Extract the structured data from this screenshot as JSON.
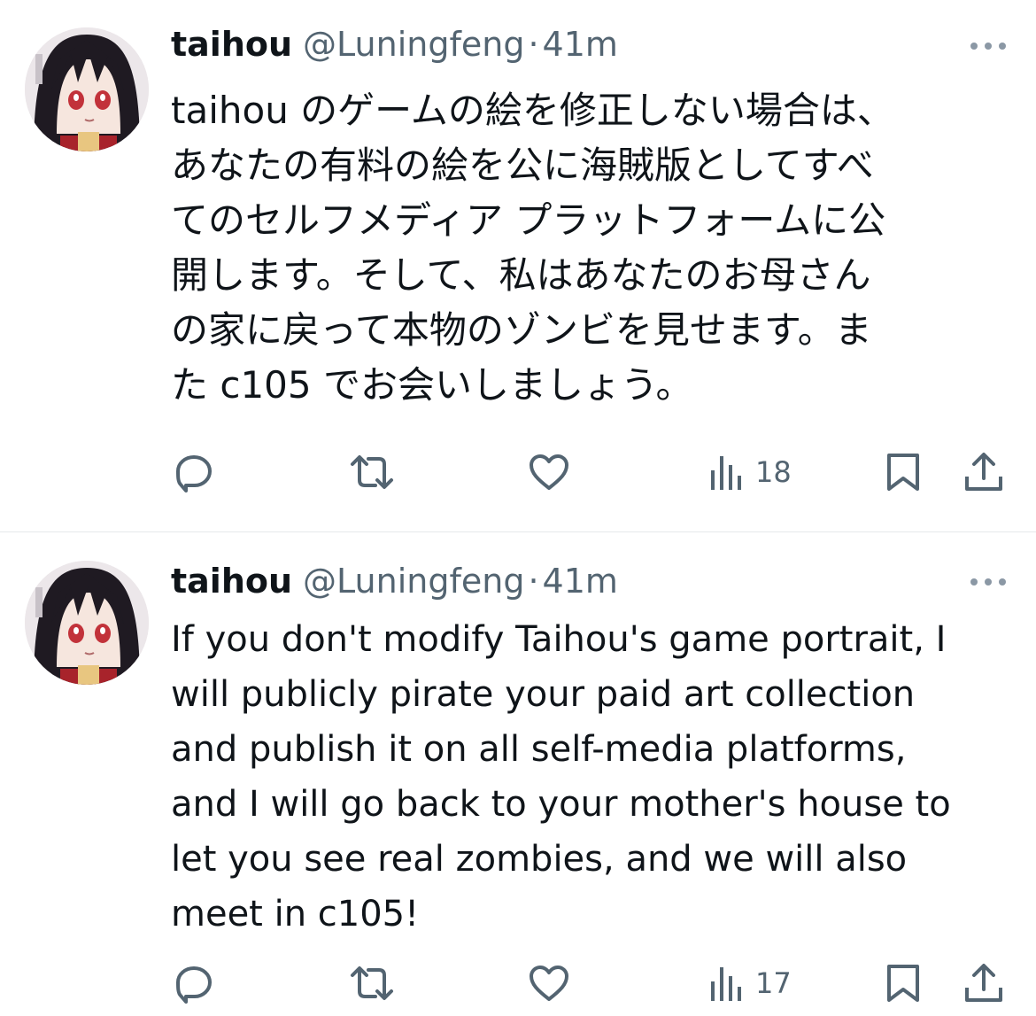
{
  "colors": {
    "text": "#0f1419",
    "secondary": "#536471",
    "divider": "#e6e9eb"
  },
  "tweets": [
    {
      "name": "taihou",
      "handle": "@Luningfeng",
      "separator": "·",
      "time": "41m",
      "text": "taihou のゲームの絵を修正しない場合は、\nあなたの有料の絵を公に海賊版としてすべ\nてのセルフメディア プラットフォームに公\n開します。そして、私はあなたのお母さん\nの家に戻って本物のゾンビを見せます。ま\nた c105 でお会いしましょう。",
      "views": "18",
      "icons": [
        "more-icon",
        "reply-icon",
        "retweet-icon",
        "like-icon",
        "views-icon",
        "bookmark-icon",
        "share-icon"
      ]
    },
    {
      "name": "taihou",
      "handle": "@Luningfeng",
      "separator": "·",
      "time": "41m",
      "text": "If you don't modify Taihou's game portrait, I\nwill publicly pirate your paid art collection\nand publish it on all self-media platforms,\nand I will go back to your mother's house to\nlet you see real zombies, and we will also\nmeet in c105!",
      "views": "17",
      "icons": [
        "more-icon",
        "reply-icon",
        "retweet-icon",
        "like-icon",
        "views-icon",
        "bookmark-icon",
        "share-icon"
      ]
    }
  ]
}
